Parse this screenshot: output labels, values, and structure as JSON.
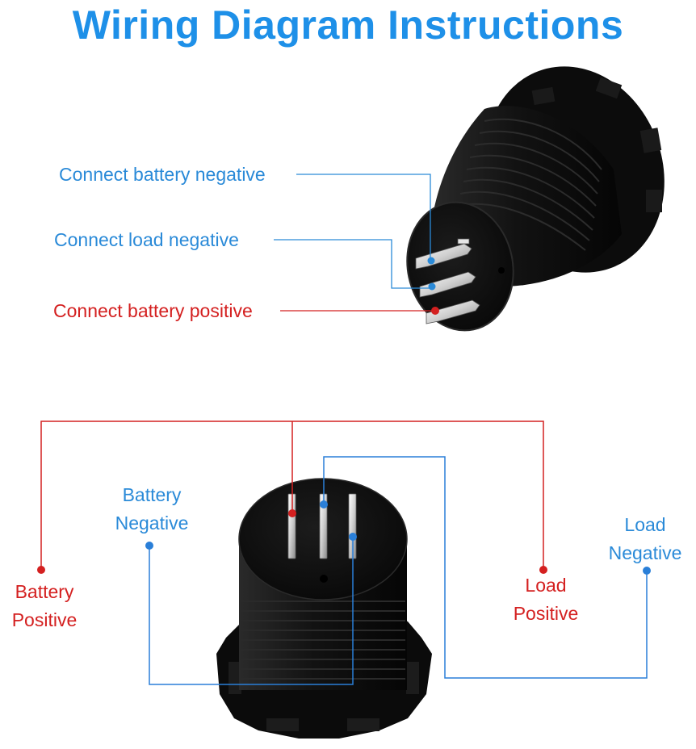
{
  "title": "Wiring Diagram Instructions",
  "top_labels": {
    "battery_negative": "Connect battery negative",
    "load_negative": "Connect  load negative",
    "battery_positive": "Connect battery positive"
  },
  "bottom_labels": {
    "battery_positive": [
      "Battery",
      "Positive"
    ],
    "battery_negative": [
      "Battery",
      "Negative"
    ],
    "load_positive": [
      "Load",
      "Positive"
    ],
    "load_negative": [
      "Load",
      "Negative"
    ]
  },
  "colors": {
    "title": "#1e90e8",
    "negative_wire": "#2a7fd8",
    "positive_wire": "#d42020"
  }
}
